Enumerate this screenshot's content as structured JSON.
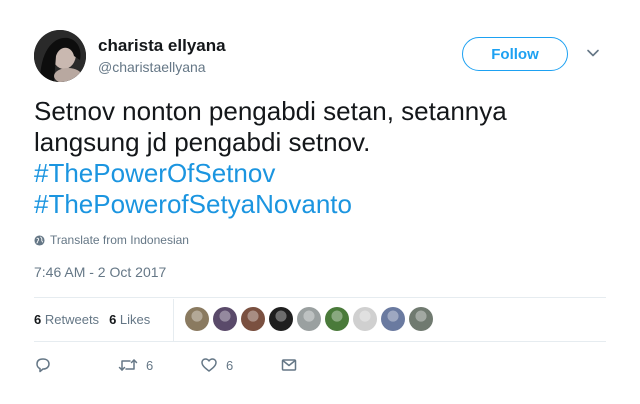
{
  "user": {
    "name": "charista ellyana",
    "handle": "@charistaellyana"
  },
  "follow_label": "Follow",
  "tweet": {
    "lines": [
      "Setnov nonton pengabdi setan, setannya",
      "langsung jd pengabdi setnov."
    ],
    "hashtags": [
      "#ThePowerOfSetnov",
      "#ThePowerofSetyaNovanto"
    ]
  },
  "translate_label": "Translate from Indonesian",
  "timestamp": "7:46 AM - 2 Oct 2017",
  "stats": {
    "retweets_count": "6",
    "retweets_label": "Retweets",
    "likes_count": "6",
    "likes_label": "Likes"
  },
  "liker_avatars": [
    {
      "color": "#8a7a60"
    },
    {
      "color": "#5a4a6a"
    },
    {
      "color": "#7a5040"
    },
    {
      "color": "#1f1f1f"
    },
    {
      "color": "#9aa0a0"
    },
    {
      "color": "#4a7a3a"
    },
    {
      "color": "#d0d0d0"
    },
    {
      "color": "#6a7aa0"
    },
    {
      "color": "#707a70"
    }
  ],
  "actions": {
    "retweet_count": "6",
    "like_count": "6"
  },
  "colors": {
    "accent": "#1da1f2",
    "hashtag": "#1b95e0",
    "muted": "#657786"
  }
}
